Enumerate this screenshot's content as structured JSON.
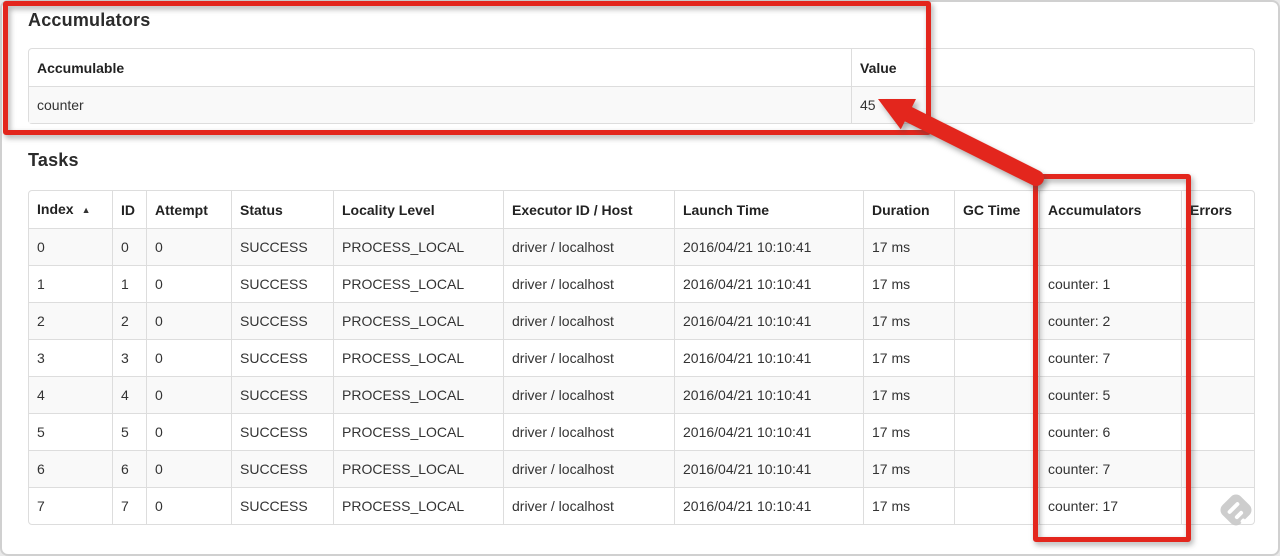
{
  "accumulators_section": {
    "heading": "Accumulators",
    "table": {
      "headers": [
        "Accumulable",
        "Value"
      ],
      "rows": [
        [
          "counter",
          "45"
        ]
      ]
    }
  },
  "tasks_section": {
    "heading": "Tasks",
    "table": {
      "headers": [
        "Index",
        "ID",
        "Attempt",
        "Status",
        "Locality Level",
        "Executor ID / Host",
        "Launch Time",
        "Duration",
        "GC Time",
        "Accumulators",
        "Errors"
      ],
      "sort_column": "Index",
      "sort_indicator": "▲",
      "rows": [
        [
          "0",
          "0",
          "0",
          "SUCCESS",
          "PROCESS_LOCAL",
          "driver / localhost",
          "2016/04/21 10:10:41",
          "17 ms",
          "",
          "",
          ""
        ],
        [
          "1",
          "1",
          "0",
          "SUCCESS",
          "PROCESS_LOCAL",
          "driver / localhost",
          "2016/04/21 10:10:41",
          "17 ms",
          "",
          "counter: 1",
          ""
        ],
        [
          "2",
          "2",
          "0",
          "SUCCESS",
          "PROCESS_LOCAL",
          "driver / localhost",
          "2016/04/21 10:10:41",
          "17 ms",
          "",
          "counter: 2",
          ""
        ],
        [
          "3",
          "3",
          "0",
          "SUCCESS",
          "PROCESS_LOCAL",
          "driver / localhost",
          "2016/04/21 10:10:41",
          "17 ms",
          "",
          "counter: 7",
          ""
        ],
        [
          "4",
          "4",
          "0",
          "SUCCESS",
          "PROCESS_LOCAL",
          "driver / localhost",
          "2016/04/21 10:10:41",
          "17 ms",
          "",
          "counter: 5",
          ""
        ],
        [
          "5",
          "5",
          "0",
          "SUCCESS",
          "PROCESS_LOCAL",
          "driver / localhost",
          "2016/04/21 10:10:41",
          "17 ms",
          "",
          "counter: 6",
          ""
        ],
        [
          "6",
          "6",
          "0",
          "SUCCESS",
          "PROCESS_LOCAL",
          "driver / localhost",
          "2016/04/21 10:10:41",
          "17 ms",
          "",
          "counter: 7",
          ""
        ],
        [
          "7",
          "7",
          "0",
          "SUCCESS",
          "PROCESS_LOCAL",
          "driver / localhost",
          "2016/04/21 10:10:41",
          "17 ms",
          "",
          "counter: 17",
          ""
        ]
      ]
    }
  },
  "annotations": {
    "color": "#e3261d",
    "box_1": "highlight-accumulators-section",
    "box_2": "highlight-accumulators-column",
    "arrow": "arrow-from-column-to-value-45"
  },
  "colors": {
    "row_stripe": "#f9f9f9",
    "table_border": "#dddddd",
    "text": "#333333"
  },
  "watermark": "feedly-logo"
}
